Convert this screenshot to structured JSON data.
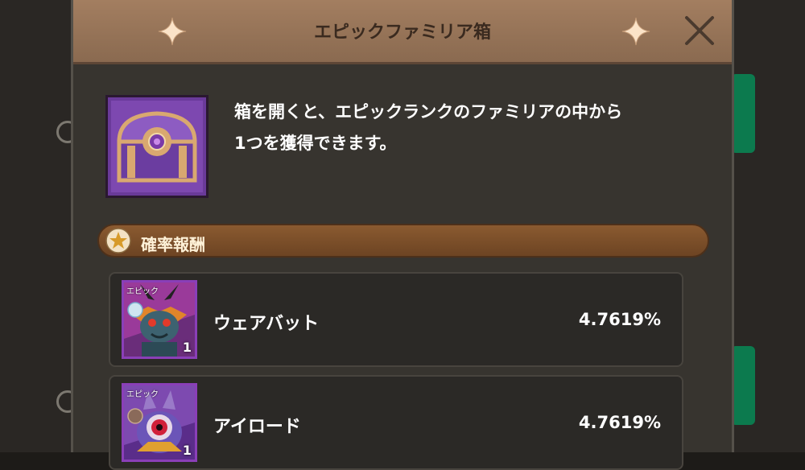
{
  "dialog": {
    "title": "エピックファミリア箱",
    "close_icon": "close-icon",
    "description_line1": "箱を開くと、エピックランクのファミリアの中から",
    "description_line2": "1つを獲得できます。"
  },
  "section": {
    "label": "確率報酬",
    "icon": "star-icon"
  },
  "rewards": [
    {
      "rank": "エピック",
      "name": "ウェアバット",
      "count": "1",
      "rate": "4.7619%"
    },
    {
      "rank": "エピック",
      "name": "アイロード",
      "count": "1",
      "rate": "4.7619%"
    }
  ],
  "colors": {
    "title_bar": "#a37e60",
    "panel": "#37342f",
    "section_bar": "#8a5a30",
    "epic_border": "#8a3fb8"
  }
}
